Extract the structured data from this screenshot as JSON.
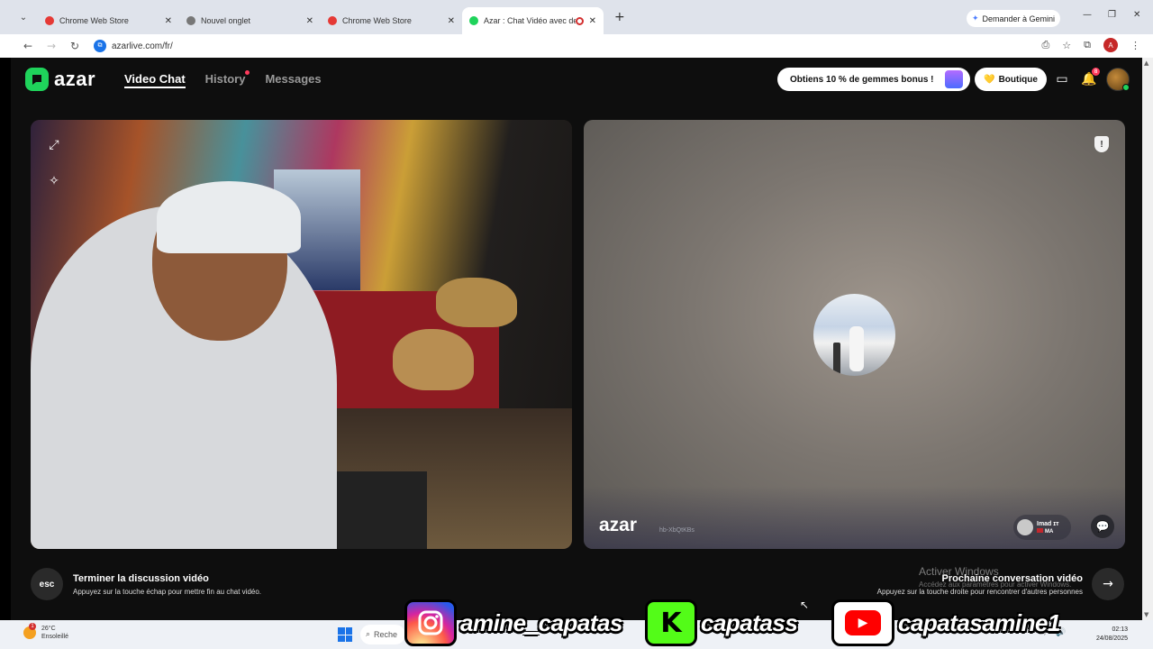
{
  "browser": {
    "tabs": [
      {
        "title": "Chrome Web Store",
        "favicon_color": "#e53935"
      },
      {
        "title": "Nouvel onglet",
        "favicon_color": "#555555"
      },
      {
        "title": "Chrome Web Store",
        "favicon_color": "#e53935"
      },
      {
        "title": "Azar : Chat Vidéo avec de n",
        "favicon_color": "#1fd35b",
        "active": true,
        "recording": true
      }
    ],
    "gemini_label": "Demander à Gemini",
    "url": "azarlive.com/fr/",
    "profile_initial": "A"
  },
  "app": {
    "logo_text": "azar",
    "nav": [
      {
        "label": "Video Chat",
        "active": true
      },
      {
        "label": "History",
        "dot": true
      },
      {
        "label": "Messages"
      }
    ],
    "promo_label": "Obtiens 10 % de gemmes bonus !",
    "boutique_label": "Boutique",
    "boutique_icon": "💛",
    "notification_count": "8",
    "partner": {
      "name": "Imad ɪᴛ",
      "country": "MA",
      "session_id": "hb-XbQtKBs"
    },
    "watermark": "azar",
    "end_call": {
      "key": "esc",
      "title": "Terminer la discussion vidéo",
      "subtitle": "Appuyez sur la touche échap pour mettre fin au chat vidéo."
    },
    "next_call": {
      "title": "Prochaine conversation vidéo",
      "subtitle": "Appuyez sur la touche droite pour rencontrer d'autres personnes"
    }
  },
  "windows_watermark": {
    "title": "Activer Windows",
    "subtitle": "Accédez aux paramètres pour activer Windows."
  },
  "taskbar": {
    "weather_temp": "26°C",
    "weather_desc": "Ensoleillé",
    "weather_badge": "1",
    "search_placeholder": "Reche",
    "time": "02:13",
    "date": "24/08/2025"
  },
  "socials": [
    {
      "platform": "instagram",
      "handle": "amine_capatas"
    },
    {
      "platform": "kick",
      "handle": "capatass",
      "icon_letter": "K"
    },
    {
      "platform": "youtube",
      "handle": "capatasamine1"
    }
  ]
}
